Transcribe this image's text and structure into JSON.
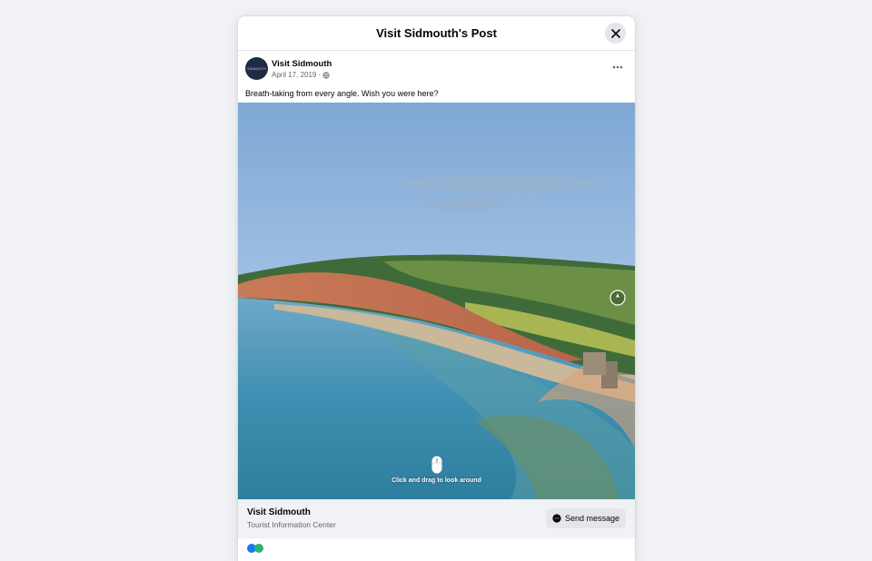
{
  "modal": {
    "title": "Visit Sidmouth's Post"
  },
  "post": {
    "author": "Visit Sidmouth",
    "avatar_text": "SIDMOUTH",
    "date": "April 17, 2019",
    "date_sep": "·",
    "privacy_icon": "globe-icon",
    "caption": "Breath-taking from every angle. Wish you were here?"
  },
  "media": {
    "hint": "Click and drag to look around",
    "hint_icon": "mouse-icon",
    "compass_icon": "compass-icon"
  },
  "page_card": {
    "name": "Visit Sidmouth",
    "category": "Tourist Information Center",
    "send_label": "Send message",
    "send_icon": "messenger-icon"
  },
  "colors": {
    "background": "#f0f2f5",
    "surface": "#ffffff",
    "secondary_text": "#65676b",
    "button_gray": "#e4e6eb"
  }
}
